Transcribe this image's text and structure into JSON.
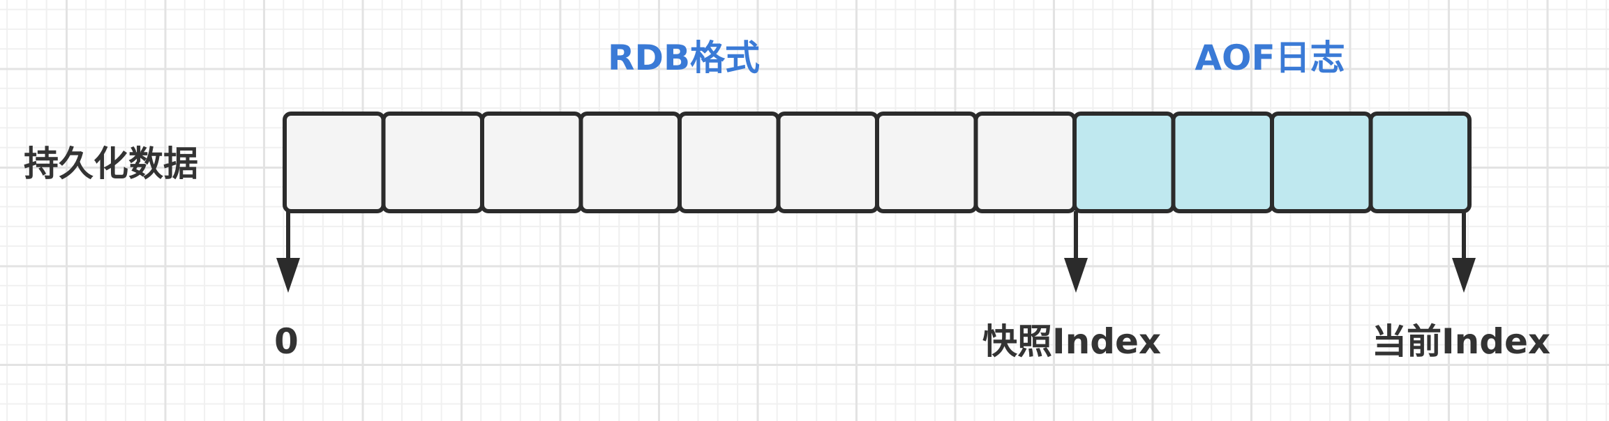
{
  "diagram": {
    "sections": [
      {
        "label": "RDB格式"
      },
      {
        "label": "AOF日志"
      }
    ],
    "row_label": "持久化数据",
    "cells": {
      "rdb_count": 8,
      "aof_count": 4
    },
    "markers": [
      {
        "label": "0"
      },
      {
        "label": "快照Index"
      },
      {
        "label": "当前Index"
      }
    ],
    "colors": {
      "rdb_fill": "#f4f4f4",
      "aof_fill": "#bfe8ef",
      "stroke": "#2b2b2b",
      "section_text": "#3a7ad6",
      "text": "#333333"
    }
  }
}
